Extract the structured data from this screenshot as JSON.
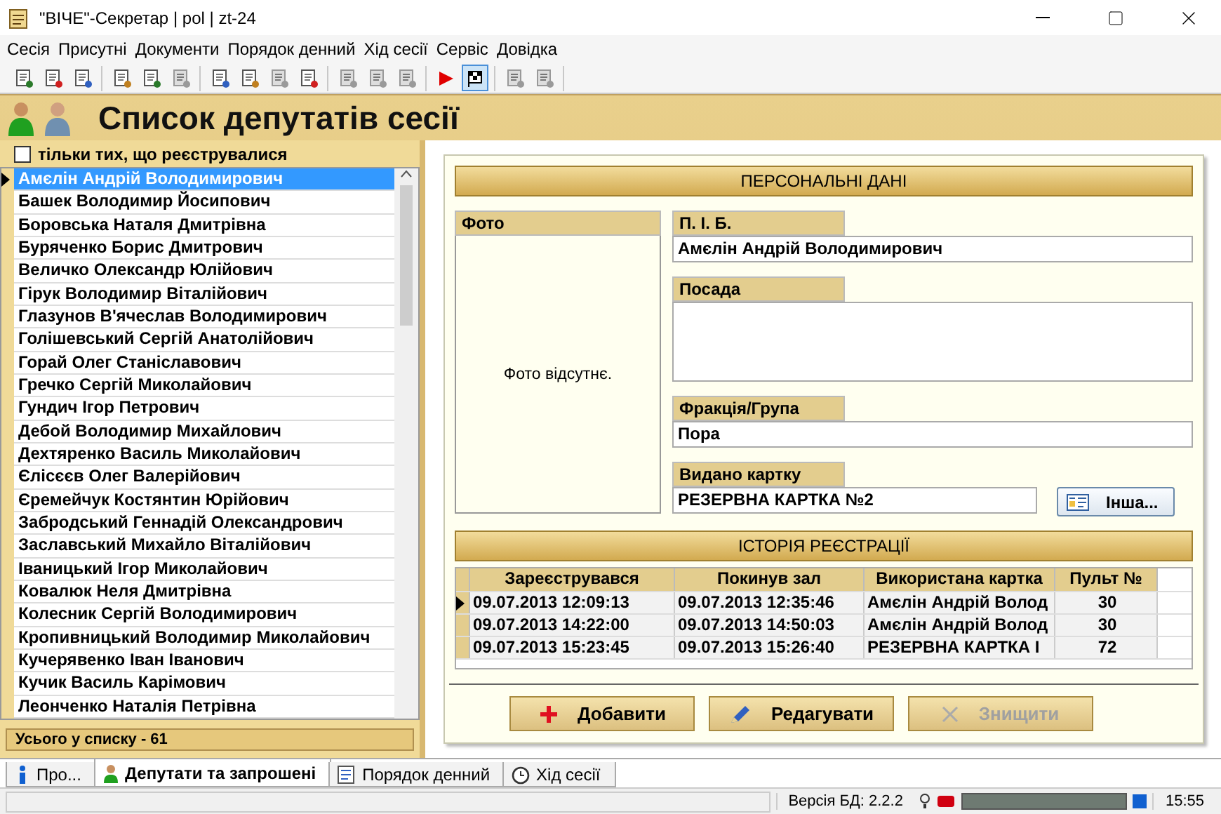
{
  "window": {
    "title": "\"ВІЧЕ\"-Секретар | pol | zt-24"
  },
  "menu": [
    "Сесія",
    "Присутні",
    "Документи",
    "Порядок денний",
    "Хід сесії",
    "Сервіс",
    "Довідка"
  ],
  "toolbar": [
    [
      {
        "disabled": false,
        "selected": false
      },
      {
        "disabled": false,
        "selected": false
      },
      {
        "disabled": false,
        "selected": false
      }
    ],
    [
      {
        "disabled": false,
        "selected": false
      },
      {
        "disabled": false,
        "selected": false
      },
      {
        "disabled": true,
        "selected": false
      }
    ],
    [
      {
        "disabled": false,
        "selected": false
      },
      {
        "disabled": false,
        "selected": false
      },
      {
        "disabled": true,
        "selected": false
      },
      {
        "disabled": false,
        "selected": false
      }
    ],
    [
      {
        "disabled": true,
        "selected": false
      },
      {
        "disabled": true,
        "selected": false
      },
      {
        "disabled": true,
        "selected": false
      }
    ],
    [
      {
        "disabled": false,
        "selected": false
      },
      {
        "disabled": false,
        "selected": true
      }
    ],
    [
      {
        "disabled": true,
        "selected": false
      },
      {
        "disabled": true,
        "selected": false
      }
    ]
  ],
  "header": {
    "title": "Список депутатів сесії"
  },
  "filter": {
    "label": "тільки тих, що реєструвалися",
    "checked": false
  },
  "deputies": [
    {
      "name": "Амєлін Андрій Володимирович",
      "selected": true
    },
    {
      "name": "Башек Володимир Йосипович",
      "selected": false
    },
    {
      "name": "Боровська Наталя Дмитрівна",
      "selected": false
    },
    {
      "name": "Буряченко Борис Дмитрович",
      "selected": false
    },
    {
      "name": "Величко Олександр Юлійович",
      "selected": false
    },
    {
      "name": "Гірук Володимир Віталійович",
      "selected": false
    },
    {
      "name": "Глазунов В'ячеслав Володимирович",
      "selected": false
    },
    {
      "name": "Голішевський Сергій Анатолійович",
      "selected": false
    },
    {
      "name": "Горай Олег Станіславович",
      "selected": false
    },
    {
      "name": "Гречко Сергій Миколайович",
      "selected": false
    },
    {
      "name": "Гундич Ігор Петрович",
      "selected": false
    },
    {
      "name": "Дебой Володимир Михайлович",
      "selected": false
    },
    {
      "name": "Дехтяренко Василь Миколайович",
      "selected": false
    },
    {
      "name": "Єлісєєв Олег Валерійович",
      "selected": false
    },
    {
      "name": "Єремейчук Костянтин Юрійович",
      "selected": false
    },
    {
      "name": "Забродський Геннадій Олександрович",
      "selected": false
    },
    {
      "name": "Заславський Михайло Віталійович",
      "selected": false
    },
    {
      "name": "Іваницький Ігор Миколайович",
      "selected": false
    },
    {
      "name": "Ковалюк Неля Дмитрівна",
      "selected": false
    },
    {
      "name": "Колесник Сергій Володимирович",
      "selected": false
    },
    {
      "name": "Кропивницький Володимир Миколайович",
      "selected": false
    },
    {
      "name": "Кучерявенко Іван Іванович",
      "selected": false
    },
    {
      "name": "Кучик Василь Карімович",
      "selected": false
    },
    {
      "name": "Леонченко Наталія Петрівна",
      "selected": false
    }
  ],
  "list_total": "Усього у списку  - 61",
  "personal": {
    "title": "ПЕРСОНАЛЬНІ ДАНІ",
    "photo_label": "Фото",
    "photo_text": "Фото відсутнє.",
    "name_label": "П. І. Б.",
    "name": "Амєлін Андрій Володимирович",
    "position_label": "Посада",
    "faction_label": "Фракція/Група",
    "faction": "Пора",
    "card_label": "Видано картку",
    "card": "РЕЗЕРВНА КАРТКА №2",
    "other_button": "Інша..."
  },
  "history": {
    "title": "ІСТОРІЯ РЕЄСТРАЦІЇ",
    "columns": [
      "Зареєструвався",
      "Покинув зал",
      "Використана картка",
      "Пульт №"
    ],
    "rows": [
      {
        "cells": [
          "09.07.2013 12:09:13",
          "09.07.2013 12:35:46",
          "Амєлін Андрій Волод",
          "30"
        ],
        "selected": true
      },
      {
        "cells": [
          "09.07.2013 14:22:00",
          "09.07.2013 14:50:03",
          "Амєлін Андрій Волод",
          "30"
        ],
        "selected": false
      },
      {
        "cells": [
          "09.07.2013 15:23:45",
          "09.07.2013 15:26:40",
          "РЕЗЕРВНА КАРТКА І",
          "72"
        ],
        "selected": false
      }
    ]
  },
  "actions": [
    {
      "kind": "add",
      "label": "Добавити",
      "disabled": false
    },
    {
      "kind": "edit",
      "label": "Редагувати",
      "disabled": false
    },
    {
      "kind": "delete",
      "label": "Знищити",
      "disabled": true
    }
  ],
  "tabs": [
    {
      "kind": "info",
      "label": "Про...",
      "selected": false
    },
    {
      "kind": "people",
      "label": "Депутати та запрошені",
      "selected": true
    },
    {
      "kind": "list",
      "label": "Порядок денний",
      "selected": false
    },
    {
      "kind": "clock",
      "label": "Хід сесії",
      "selected": false
    }
  ],
  "status_bar": {
    "db_version": "Версія БД: 2.2.2",
    "progress": {
      "level": 1
    },
    "time": "15:55"
  }
}
